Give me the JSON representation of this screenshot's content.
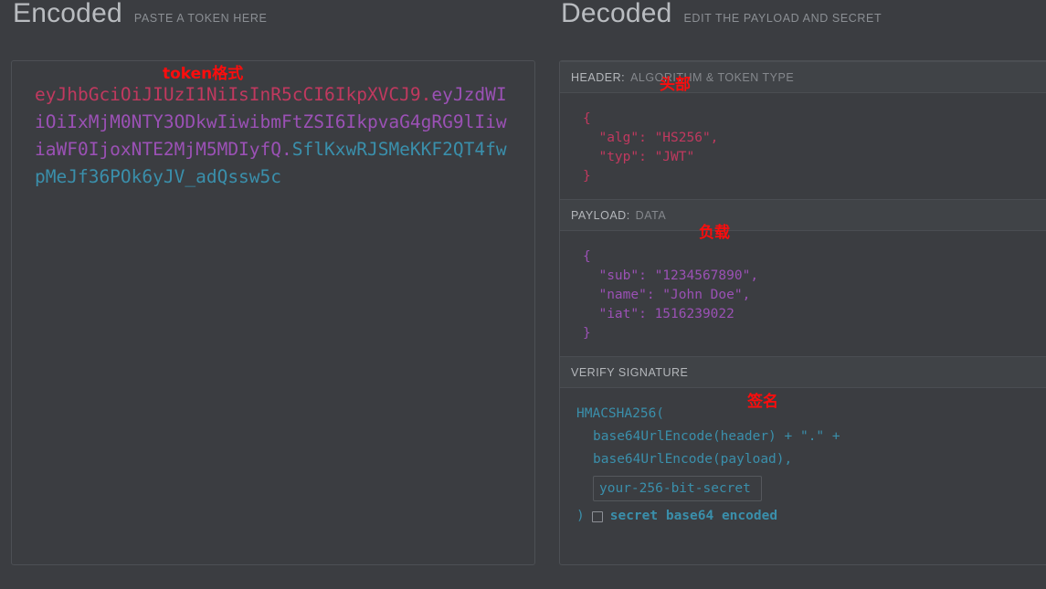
{
  "encoded": {
    "title": "Encoded",
    "subtitle": "PASTE A TOKEN HERE",
    "token": {
      "header": "eyJhbGciOiJIUzI1NiIsInR5cCI6IkpXVCJ9",
      "payload": "eyJzdWIiOiIxMjM0NTY3ODkwIiwibmFtZSI6IkpvaG4gRG9lIiwiaWF0IjoxNTE2MjM5MDIyfQ",
      "signature": "SflKxwRJSMeKKF2QT4fwpMeJf36POk6yJV_adQssw5c",
      "separator": "."
    }
  },
  "decoded": {
    "title": "Decoded",
    "subtitle": "EDIT THE PAYLOAD AND SECRET",
    "header_section": {
      "label": "HEADER:",
      "sublabel": "ALGORITHM & TOKEN TYPE",
      "json": "{\n  \"alg\": \"HS256\",\n  \"typ\": \"JWT\"\n}"
    },
    "payload_section": {
      "label": "PAYLOAD:",
      "sublabel": "DATA",
      "json": "{\n  \"sub\": \"1234567890\",\n  \"name\": \"John Doe\",\n  \"iat\": 1516239022\n}"
    },
    "signature_section": {
      "label": "VERIFY SIGNATURE",
      "line1": "HMACSHA256(",
      "line2": "base64UrlEncode(header) + \".\" +",
      "line3": "base64UrlEncode(payload),",
      "secret_value": "your-256-bit-secret",
      "closing_paren": ")",
      "base64_label": "secret base64 encoded",
      "base64_checked": false
    }
  },
  "annotations": {
    "token_format": "token格式",
    "header": "头部",
    "payload": "负载",
    "signature": "签名"
  },
  "colors": {
    "background": "#3b3d41",
    "panel_border": "#4d5055",
    "header_segment": "#c0395f",
    "payload_segment": "#9b51b5",
    "signature_segment": "#3a8fab",
    "annotation_red": "#fc0d0d",
    "title_text": "#b9bcc0",
    "subtitle_text": "#8b8f94"
  }
}
